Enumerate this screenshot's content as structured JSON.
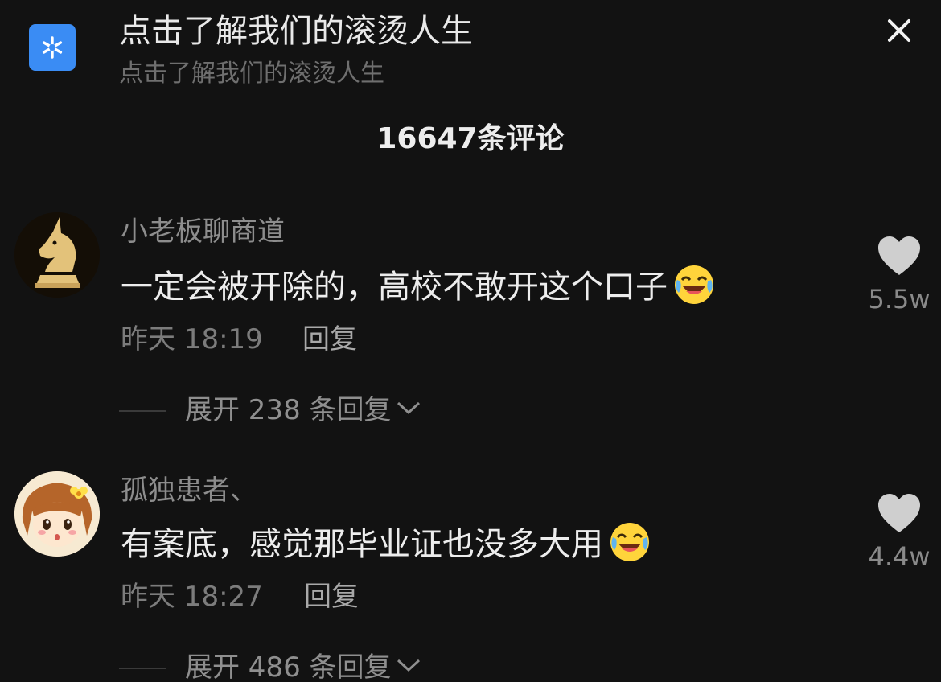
{
  "header": {
    "title": "点击了解我们的滚烫人生",
    "subtitle": "点击了解我们的滚烫人生",
    "icon": "snowflake-app-icon",
    "close_icon": "close-icon",
    "accent": "#3a8cf4"
  },
  "comment_count": "16647条评论",
  "comments": [
    {
      "author": "小老板聊商道",
      "text": "一定会被开除的，高校不敢开这个口子",
      "emoji": "crying-laughing-emoji",
      "time": "昨天 18:19",
      "reply_label": "回复",
      "expand_label": "展开 238 条回复",
      "likes": "5.5w",
      "avatar": "unicorn-chess-knight-avatar"
    },
    {
      "author": "孤独患者、",
      "text": "有案底，感觉那毕业证也没多大用",
      "emoji": "crying-laughing-emoji",
      "time": "昨天 18:27",
      "reply_label": "回复",
      "expand_label": "展开 486 条回复",
      "likes": "4.4w",
      "avatar": "cartoon-girl-avatar"
    }
  ]
}
